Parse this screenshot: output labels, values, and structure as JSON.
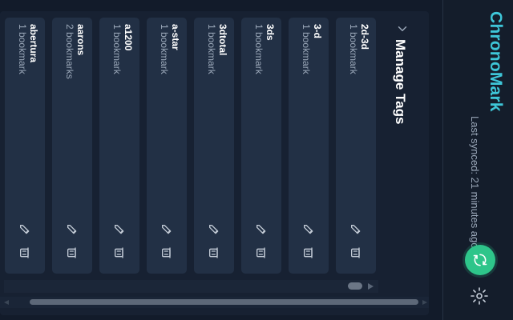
{
  "header": {
    "title": "ChronoMark",
    "sync_status": "Last synced: 21 minutes ago",
    "sync_icon": "sync-icon",
    "settings_icon": "settings-icon",
    "accent_color": "#3ec6d8",
    "sync_color": "#2ec58a"
  },
  "tags_panel": {
    "title": "Manage Tags",
    "collapse_icon": "chevron-up-icon",
    "tags": [
      {
        "name": "2d-3d",
        "count": "1 bookmark"
      },
      {
        "name": "3-d",
        "count": "1 bookmark"
      },
      {
        "name": "3ds",
        "count": "1 bookmark"
      },
      {
        "name": "3dtotal",
        "count": "1 bookmark"
      },
      {
        "name": "a-star",
        "count": "1 bookmark"
      },
      {
        "name": "a1200",
        "count": "1 bookmark"
      },
      {
        "name": "aarons",
        "count": "2 bookmarks"
      },
      {
        "name": "abertura",
        "count": "1 bookmark"
      }
    ],
    "edit_icon": "edit-icon",
    "delete_icon": "delete-icon"
  }
}
